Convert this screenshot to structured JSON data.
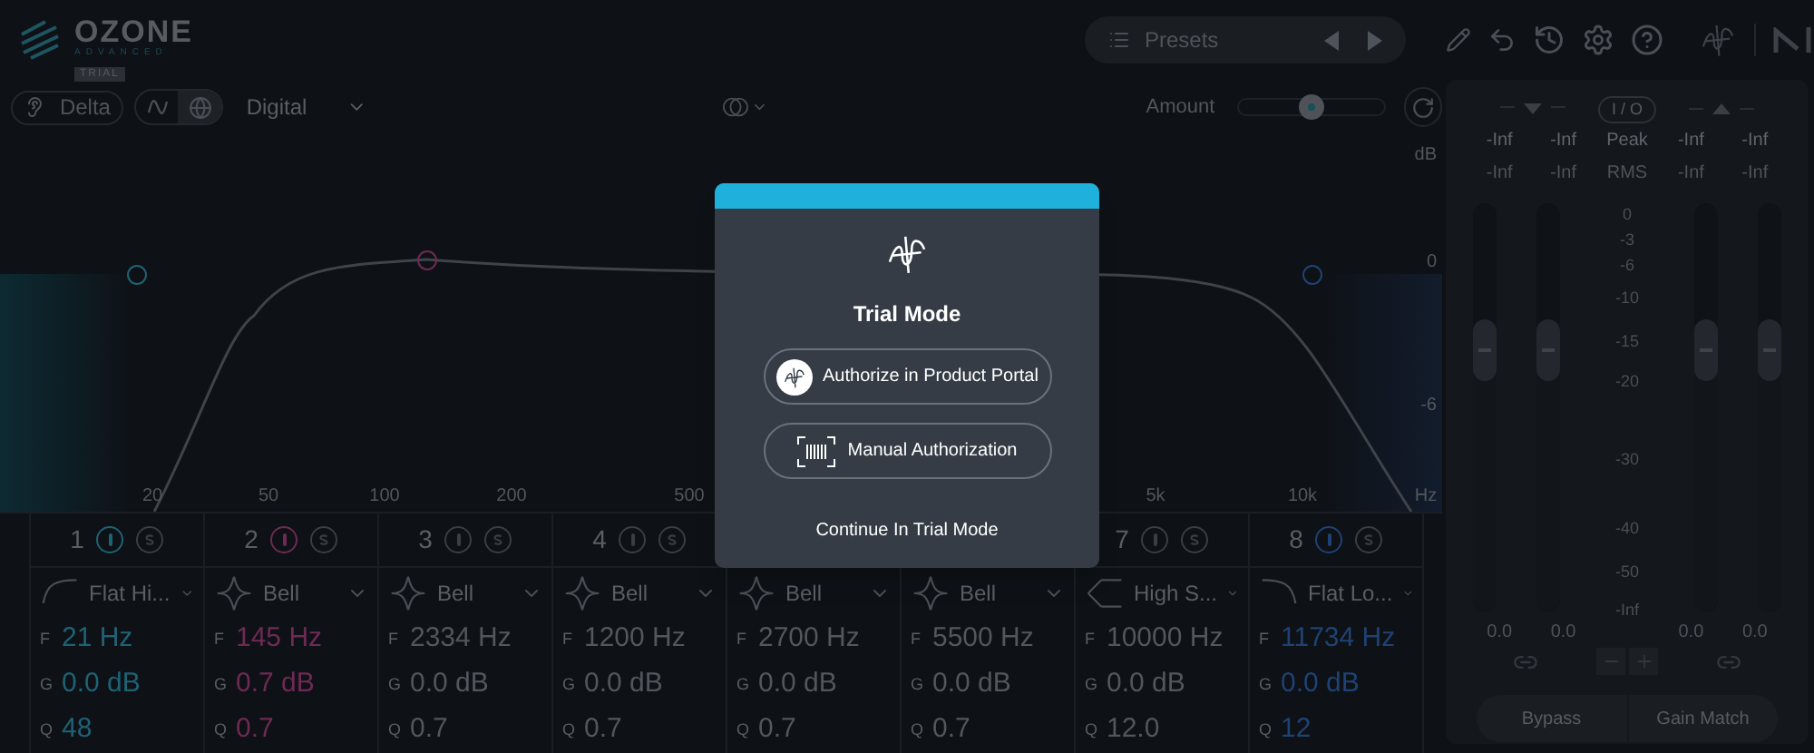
{
  "app": {
    "logo": "OZONE",
    "edition": "ADVANCED",
    "badge": "TRIAL"
  },
  "toolbar": {
    "presets": "Presets"
  },
  "controls": {
    "delta": "Delta",
    "views": [
      {
        "kind": "wave",
        "selected": false
      },
      {
        "kind": "globe",
        "selected": true
      }
    ],
    "mode": "Digital",
    "amount_label": "Amount",
    "amount": {
      "level": 0.5
    }
  },
  "graph": {
    "db_labels": [
      "dB",
      "0",
      "-6"
    ],
    "freq_labels": [
      "20",
      "50",
      "100",
      "200",
      "500",
      "5k",
      "10k",
      "Hz"
    ]
  },
  "bands": [
    {
      "number": "1",
      "kind": "flat_high",
      "filter": "Flat Hi...",
      "params": [
        {
          "label": "F",
          "value": "21 Hz"
        },
        {
          "label": "G",
          "value": "0.0 dB"
        },
        {
          "label": "Q",
          "value": "48"
        }
      ],
      "color": "#1e6275"
    },
    {
      "number": "2",
      "kind": "bell",
      "filter": "Bell",
      "params": [
        {
          "label": "F",
          "value": "145 Hz"
        },
        {
          "label": "G",
          "value": "0.7 dB"
        },
        {
          "label": "Q",
          "value": "0.7"
        }
      ],
      "color": "#6e2a55"
    },
    {
      "number": "3",
      "kind": "bell",
      "filter": "Bell",
      "params": [
        {
          "label": "F",
          "value": "2334 Hz"
        },
        {
          "label": "G",
          "value": "0.0 dB"
        },
        {
          "label": "Q",
          "value": "0.7"
        }
      ]
    },
    {
      "number": "4",
      "kind": "bell",
      "filter": "Bell",
      "params": [
        {
          "label": "F",
          "value": "1200 Hz"
        },
        {
          "label": "G",
          "value": "0.0 dB"
        },
        {
          "label": "Q",
          "value": "0.7"
        }
      ]
    },
    {
      "kind": "bell",
      "filter": "Bell",
      "params": [
        {
          "label": "F",
          "value": "2700 Hz"
        },
        {
          "label": "G",
          "value": "0.0 dB"
        },
        {
          "label": "Q",
          "value": "0.7"
        }
      ]
    },
    {
      "kind": "bell",
      "filter": "Bell",
      "params": [
        {
          "label": "F",
          "value": "5500 Hz"
        },
        {
          "label": "G",
          "value": "0.0 dB"
        },
        {
          "label": "Q",
          "value": "0.7"
        }
      ]
    },
    {
      "number": "7",
      "kind": "high_shelf",
      "filter": "High S...",
      "params": [
        {
          "label": "F",
          "value": "10000 Hz"
        },
        {
          "label": "G",
          "value": "0.0 dB"
        },
        {
          "label": "Q",
          "value": "12.0"
        }
      ]
    },
    {
      "number": "8",
      "kind": "flat_low",
      "filter": "Flat Lo...",
      "params": [
        {
          "label": "F",
          "value": "11734 Hz"
        },
        {
          "label": "G",
          "value": "0.0 dB"
        },
        {
          "label": "Q",
          "value": "12"
        }
      ],
      "color": "#1f4275"
    }
  ],
  "meters": {
    "io": "I / O",
    "peak_label": "Peak",
    "rms_label": "RMS",
    "peak": [
      "-Inf",
      "-Inf",
      "-Inf",
      "-Inf"
    ],
    "rms": [
      "-Inf",
      "-Inf",
      "-Inf",
      "-Inf"
    ],
    "scale": [
      "0",
      "-3",
      "-6",
      "-10",
      "-15",
      "-20",
      "-30",
      "-40",
      "-50",
      "-Inf"
    ],
    "faders": [
      {
        "level": 0.64
      },
      {
        "level": 0.64
      },
      {
        "level": 0.64
      },
      {
        "level": 0.64
      }
    ],
    "gains": [
      "0.0",
      "0.0",
      "0.0",
      "0.0"
    ],
    "buttons": [
      "Bypass",
      "Gain Match"
    ]
  },
  "dialog": {
    "title": "Trial Mode",
    "buttons": [
      "Authorize in Product Portal",
      "Manual Authorization"
    ],
    "link": "Continue In Trial Mode"
  }
}
